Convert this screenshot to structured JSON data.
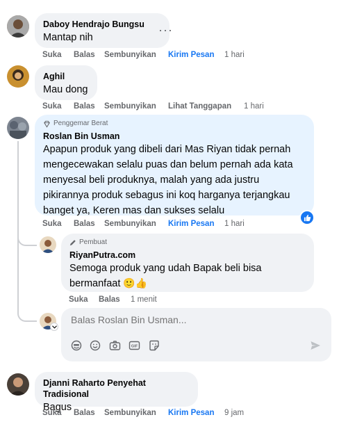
{
  "comments": [
    {
      "author": "Daboy Hendrajo Bungsu",
      "text": "Mantap nih",
      "actions": [
        "Suka",
        "Balas",
        "Sembunyikan"
      ],
      "link": "Kirim Pesan",
      "time": "1 hari"
    },
    {
      "author": "Aghil",
      "text": "Mau dong",
      "actions": [
        "Suka",
        "Balas",
        "Sembunyikan"
      ],
      "link": "Lihat Tanggapan",
      "time": "1 hari"
    },
    {
      "badge": "Penggemar Berat",
      "author": "Roslan Bin Usman",
      "text_lines": [
        "Apapun produk yang dibeli dari Mas Riyan tidak pernah",
        "mengecewakan selalu puas dan belum pernah ada kata",
        "menyesal beli produknya, malah yang ada justru",
        "pikirannya produk sebagus ini koq harganya terjangkau",
        "banget ya, Keren mas dan sukses selalu"
      ],
      "actions": [
        "Suka",
        "Balas",
        "Sembunyikan"
      ],
      "link": "Kirim Pesan",
      "time": "1 hari"
    },
    {
      "author": "Djanni Raharto Penyehat Tradisional",
      "text": "Bagus",
      "actions": [
        "Suka",
        "Balas",
        "Sembunyikan"
      ],
      "link": "Kirim Pesan",
      "time": "9 jam"
    }
  ],
  "reply": {
    "badge": "Pembuat",
    "author": "RiyanPutra.com",
    "text_lines": [
      "Semoga produk yang udah Bapak beli bisa",
      "bermanfaat"
    ],
    "emoji": "🙂👍",
    "actions": [
      "Suka",
      "Balas"
    ],
    "time": "1 menit"
  },
  "reply_box": {
    "placeholder": "Balas Roslan Bin Usman..."
  },
  "more_options": "···",
  "colors": {
    "link": "#1877f2",
    "bubble": "#f0f2f5",
    "highlight_bubble": "#e7f3ff",
    "secondary_text": "#65676b"
  }
}
